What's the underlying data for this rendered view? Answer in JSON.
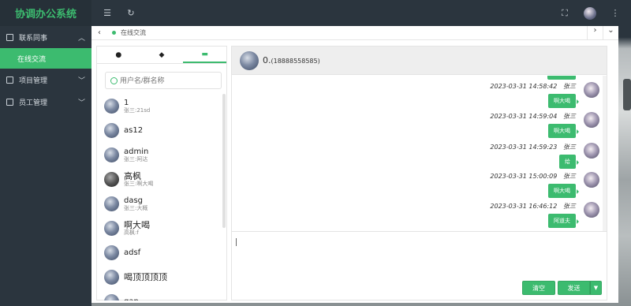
{
  "app": {
    "title": "协调办公系统"
  },
  "sidebar": {
    "items": [
      {
        "label": "联系同事",
        "icon": "contact-icon",
        "expanded": true
      },
      {
        "label": "在线交流",
        "active": true
      },
      {
        "label": "项目管理",
        "icon": "project-icon",
        "expanded": false
      },
      {
        "label": "员工管理",
        "icon": "staff-icon",
        "expanded": false
      }
    ]
  },
  "topbar": {
    "menu_icon": "☰",
    "refresh_icon": "↻",
    "fullscreen_icon": "⛶",
    "more_icon": "⋮"
  },
  "tabs": {
    "active": "在线交流"
  },
  "contacts": {
    "tabs": [
      "user-icon",
      "group-icon",
      "chat-icon"
    ],
    "search_placeholder": "用户名/群名称",
    "items": [
      {
        "name": "1",
        "sub": "张三:21sd"
      },
      {
        "name": "as12",
        "sub": ""
      },
      {
        "name": "admin",
        "sub": "张三:阿达"
      },
      {
        "name": "高枫",
        "sub": "张三:啊大喝"
      },
      {
        "name": "dasg",
        "sub": "张三:大概"
      },
      {
        "name": "啊大喝",
        "sub": "高枫:f"
      },
      {
        "name": "adsf",
        "sub": ""
      },
      {
        "name": "喝顶顶顶顶",
        "sub": ""
      },
      {
        "name": "gan",
        "sub": ""
      }
    ]
  },
  "chat": {
    "title": "0.",
    "phone": "(18888558585)",
    "messages": [
      {
        "time": "2023-03-31 14:58:42",
        "sender": "张三",
        "text": "啊大喝"
      },
      {
        "time": "2023-03-31 14:59:04",
        "sender": "张三",
        "text": "啊大喝"
      },
      {
        "time": "2023-03-31 14:59:23",
        "sender": "张三",
        "text": "给"
      },
      {
        "time": "2023-03-31 15:00:09",
        "sender": "张三",
        "text": "啊大喝"
      },
      {
        "time": "2023-03-31 16:46:12",
        "sender": "张三",
        "text": "阿道夫"
      }
    ],
    "clear_label": "清空",
    "send_label": "发送"
  },
  "colors": {
    "accent": "#3cbb6f",
    "sidebar": "#2b353e"
  }
}
